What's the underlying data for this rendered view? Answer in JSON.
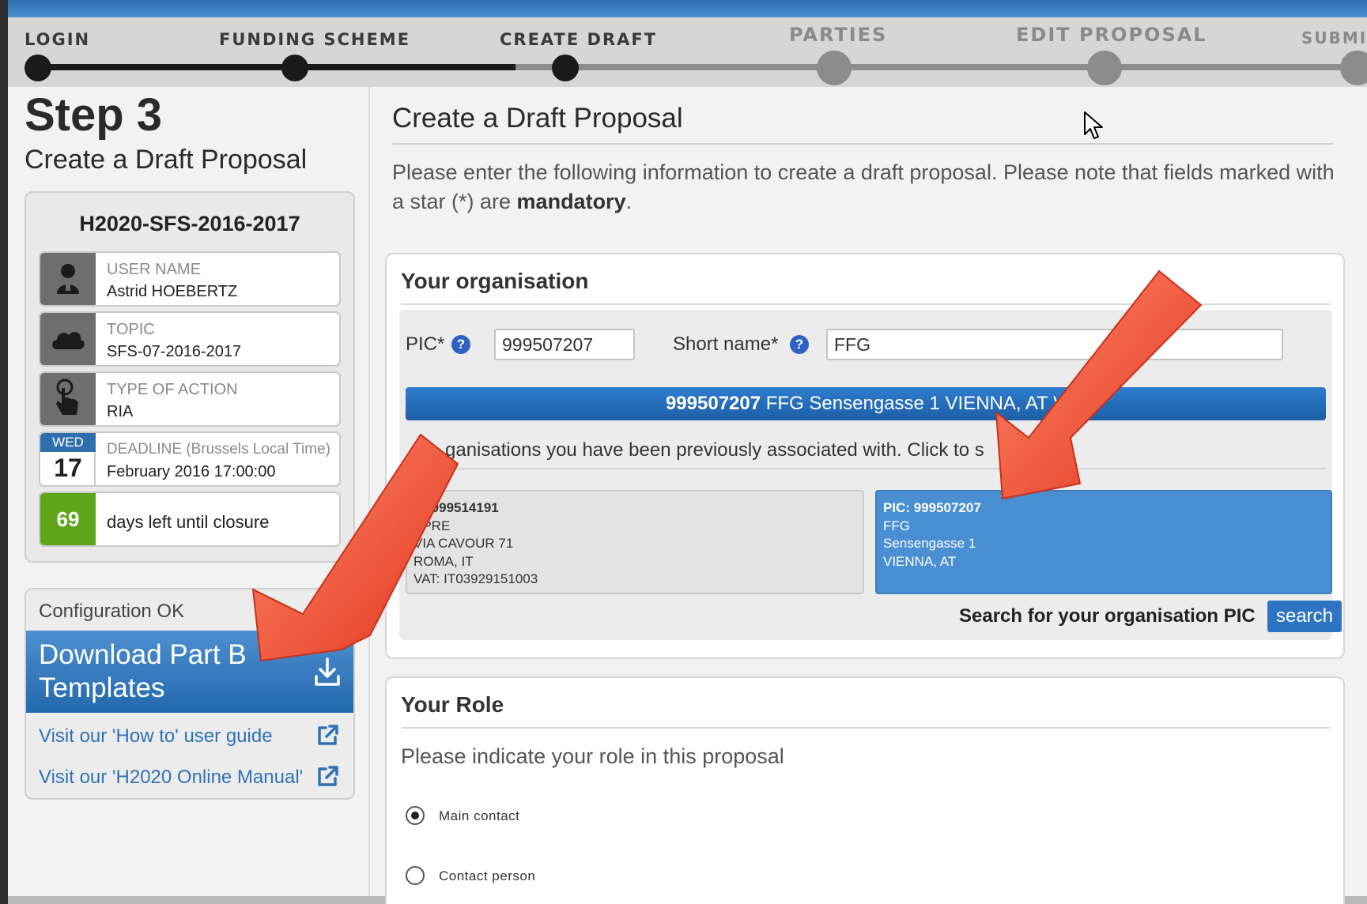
{
  "stepper": {
    "steps": [
      {
        "label": "LOGIN",
        "state": "done"
      },
      {
        "label": "FUNDING SCHEME",
        "state": "done"
      },
      {
        "label": "CREATE DRAFT",
        "state": "current"
      },
      {
        "label": "PARTIES",
        "state": "todo"
      },
      {
        "label": "EDIT PROPOSAL",
        "state": "todo"
      },
      {
        "label": "SUBMIT",
        "state": "todo"
      }
    ]
  },
  "sidebar": {
    "step_number": "Step 3",
    "step_title": "Create a Draft Proposal",
    "call_id": "H2020-SFS-2016-2017",
    "user": {
      "label": "USER NAME",
      "value": "Astrid HOEBERTZ",
      "icon": "user-icon"
    },
    "topic": {
      "label": "TOPIC",
      "value": "SFS-07-2016-2017",
      "icon": "cloud-icon"
    },
    "action": {
      "label": "TYPE OF ACTION",
      "value": "RIA",
      "icon": "pointer-icon"
    },
    "deadline": {
      "label": "DEADLINE (Brussels Local Time)",
      "value": "February 2016 17:00:00",
      "weekday": "WED",
      "day": "17"
    },
    "days_left": {
      "count": "69",
      "text": "days left until closure"
    },
    "config_status": "Configuration OK",
    "download_label": "Download Part B Templates",
    "link_guide": "Visit our 'How to' user guide",
    "link_manual": "Visit our 'H2020 Online Manual'"
  },
  "main": {
    "title": "Create a Draft Proposal",
    "intro_text": "Please enter the following information to create a draft proposal. Please note that fields marked with a star (*) are ",
    "intro_bold": "mandatory",
    "intro_end": ".",
    "organisation": {
      "title": "Your organisation",
      "pic_label": "PIC*",
      "pic_value": "999507207",
      "short_name_label": "Short name*",
      "short_name_value": "FFG",
      "selected_pic": "999507207",
      "selected_text": " FFG Sensengasse 1 VIENNA, AT V",
      "assoc_text": "ganisations you have been previously associated with. Click to s",
      "orgs": [
        {
          "pic": "C: 999514191",
          "name": "APRE",
          "street": "VIA CAVOUR 71",
          "city": "ROMA, IT",
          "vat": "VAT: IT03929151003"
        },
        {
          "pic": "PIC: 999507207",
          "name": "FFG",
          "street": "Sensengasse 1",
          "city": "VIENNA, AT"
        }
      ],
      "search_label": "Search for your organisation PIC",
      "search_button": "search"
    },
    "role": {
      "title": "Your Role",
      "prompt": "Please indicate your role in this proposal",
      "options": [
        "Main contact",
        "Contact person"
      ],
      "selected": "Main contact"
    }
  },
  "colors": {
    "accent_blue": "#2f6fb0",
    "days_left_green": "#5ea51a",
    "annotation_arrow": "#e8412c"
  }
}
